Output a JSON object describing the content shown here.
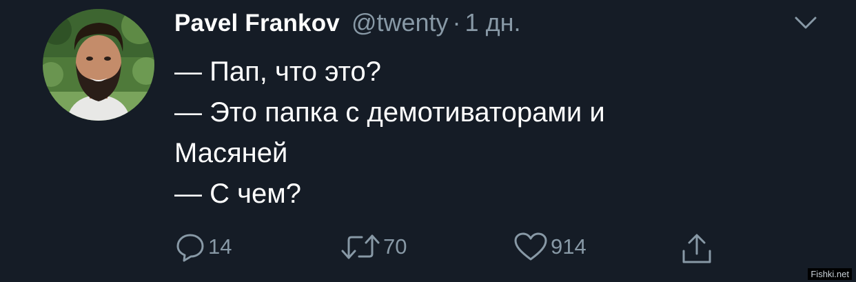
{
  "author": {
    "name": "Pavel Frankov",
    "handle": "@twenty",
    "separator": "·",
    "time": "1 дн."
  },
  "tweet": {
    "lines": [
      "— Пап, что это?",
      "— Это папка с демотиваторами и",
      "Масяней",
      "— С чем?"
    ]
  },
  "actions": {
    "reply": {
      "icon": "reply-icon",
      "count": "14"
    },
    "retweet": {
      "icon": "retweet-icon",
      "count": "70"
    },
    "like": {
      "icon": "heart-icon",
      "count": "914"
    },
    "share": {
      "icon": "share-icon"
    }
  },
  "menu": {
    "icon": "chevron-down-icon"
  },
  "watermark": "Fishki.net",
  "colors": {
    "background": "#151c26",
    "text": "#ffffff",
    "muted": "#8899a6"
  }
}
